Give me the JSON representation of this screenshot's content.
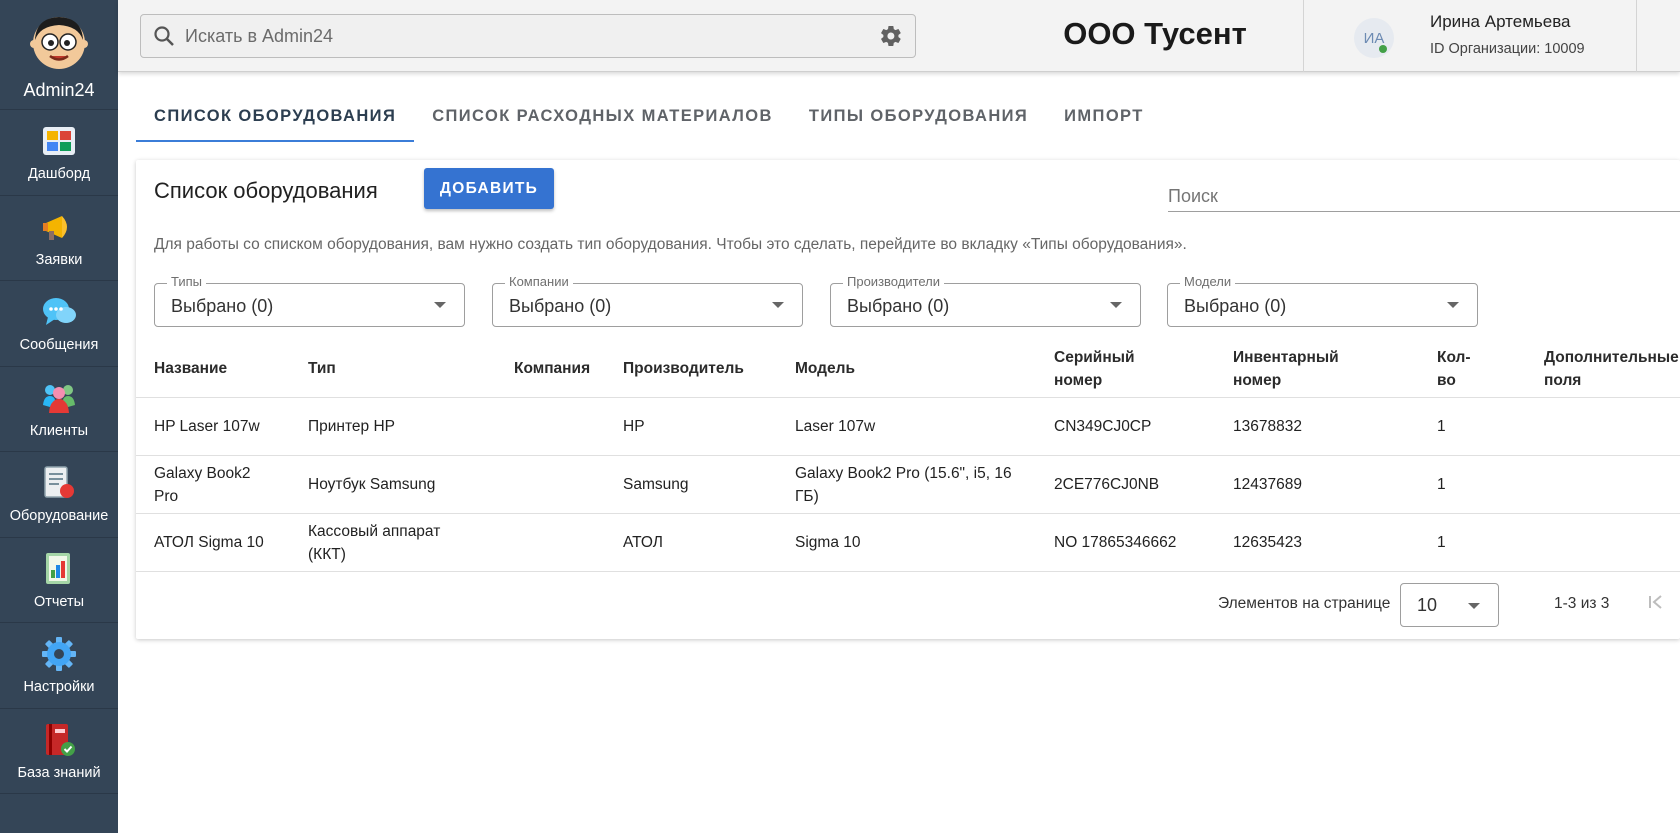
{
  "sidebar": {
    "brand": "Admin24",
    "items": [
      {
        "label": "Дашборд"
      },
      {
        "label": "Заявки"
      },
      {
        "label": "Сообщения"
      },
      {
        "label": "Клиенты"
      },
      {
        "label": "Оборудование"
      },
      {
        "label": "Отчеты"
      },
      {
        "label": "Настройки"
      },
      {
        "label": "База знаний"
      }
    ]
  },
  "header": {
    "search_placeholder": "Искать в Admin24",
    "org_title": "ООО Тусент",
    "user_initials": "ИА",
    "user_name": "Ирина Артемьева",
    "org_id": "ID Организации: 10009"
  },
  "tabs": [
    {
      "label": "СПИСОК ОБОРУДОВАНИЯ",
      "active": true
    },
    {
      "label": "СПИСОК РАСХОДНЫХ МАТЕРИАЛОВ",
      "active": false
    },
    {
      "label": "ТИПЫ ОБОРУДОВАНИЯ",
      "active": false
    },
    {
      "label": "ИМПОРТ",
      "active": false
    }
  ],
  "card": {
    "title": "Список оборудования",
    "add_label": "ДОБАВИТЬ",
    "search_placeholder": "Поиск",
    "info": "Для работы со списком оборудования, вам нужно создать тип оборудования. Чтобы это сделать, перейдите во вкладку «Типы оборудования».",
    "filters": [
      {
        "label": "Типы",
        "value": "Выбрано (0)"
      },
      {
        "label": "Компании",
        "value": "Выбрано (0)"
      },
      {
        "label": "Производители",
        "value": "Выбрано (0)"
      },
      {
        "label": "Модели",
        "value": "Выбрано (0)"
      }
    ],
    "columns": {
      "name": "Название",
      "type": "Тип",
      "company": "Компания",
      "manufacturer": "Производитель",
      "model": "Модель",
      "serial_1": "Серийный",
      "serial_2": "номер",
      "inventory_1": "Инвентарный",
      "inventory_2": "номер",
      "qty_1": "Кол-",
      "qty_2": "во",
      "extra_1": "Дополнительные",
      "extra_2": "поля"
    },
    "rows": [
      {
        "name_1": "HP Laser 107w",
        "name_2": "",
        "type_1": "Принтер HP",
        "type_2": "",
        "company": "",
        "manufacturer": "HP",
        "model_1": "Laser 107w",
        "model_2": "",
        "serial": "CN349CJ0CP",
        "inventory": "13678832",
        "qty": "1"
      },
      {
        "name_1": "Galaxy Book2",
        "name_2": "Pro",
        "type_1": "Ноутбук Samsung",
        "type_2": "",
        "company": "",
        "manufacturer": "Samsung",
        "model_1": "Galaxy Book2 Pro (15.6\", i5, 16",
        "model_2": "ГБ)",
        "serial": "2CE776CJ0NB",
        "inventory": "12437689",
        "qty": "1"
      },
      {
        "name_1": "АТОЛ Sigma 10",
        "name_2": "",
        "type_1": "Кассовый аппарат",
        "type_2": "(ККТ)",
        "company": "",
        "manufacturer": "АТОЛ",
        "model_1": "Sigma 10",
        "model_2": "",
        "serial": "NO 17865346662",
        "inventory": "12635423",
        "qty": "1"
      }
    ],
    "pager": {
      "label": "Элементов на странице",
      "per_page": "10",
      "range": "1-3 из 3"
    }
  },
  "colors": {
    "sidebar_bg": "#344557",
    "accent": "#3573d1",
    "online": "#43a047"
  }
}
